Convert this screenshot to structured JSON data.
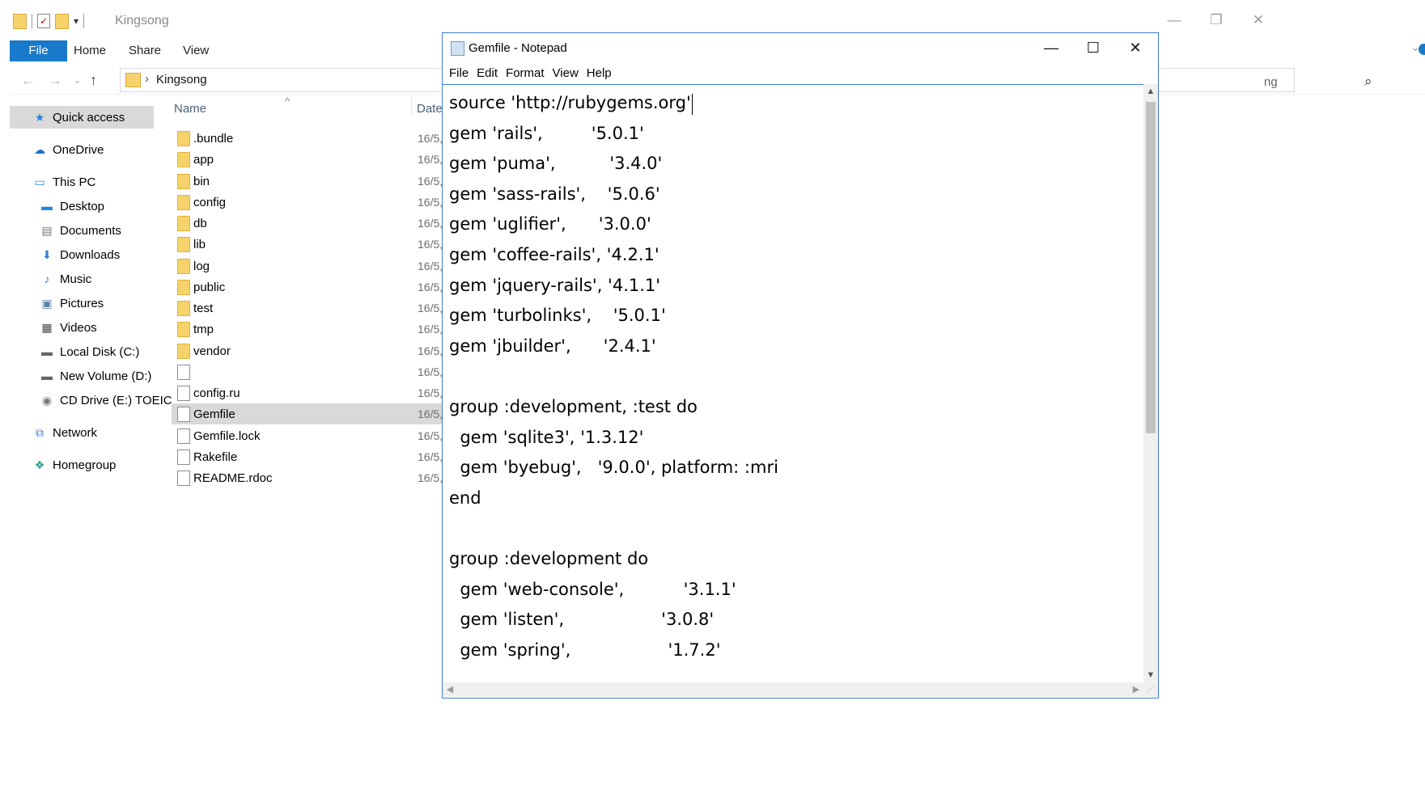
{
  "explorer": {
    "title": "Kingsong",
    "window_controls": {
      "minimize": "—",
      "restore": "❐",
      "close": "✕"
    },
    "ribbon": {
      "file": "File",
      "home": "Home",
      "share": "Share",
      "view": "View"
    },
    "nav_glyphs": {
      "back": "←",
      "forward": "→",
      "recent": "⌄",
      "up": "↑",
      "path_sep": "›",
      "chevron": "⌄",
      "search": "⌕"
    },
    "address": {
      "path": "Kingsong"
    },
    "search": {
      "partial_text": "ng"
    },
    "nav_pane": {
      "quick_access": "Quick access",
      "onedrive": "OneDrive",
      "this_pc": "This PC",
      "desktop": "Desktop",
      "documents": "Documents",
      "downloads": "Downloads",
      "music": "Music",
      "pictures": "Pictures",
      "videos": "Videos",
      "local_disk": "Local Disk (C:)",
      "new_volume": "New Volume (D:)",
      "cd_drive": "CD Drive (E:) TOEIC",
      "network": "Network",
      "homegroup": "Homegroup"
    },
    "columns": {
      "name": "Name",
      "date": "Date",
      "sort_glyph": "^"
    },
    "files": [
      {
        "name": ".bundle",
        "date": "16/5,",
        "kind": "folder"
      },
      {
        "name": "app",
        "date": "16/5,",
        "kind": "folder"
      },
      {
        "name": "bin",
        "date": "16/5,",
        "kind": "folder"
      },
      {
        "name": "config",
        "date": "16/5,",
        "kind": "folder"
      },
      {
        "name": "db",
        "date": "16/5,",
        "kind": "folder"
      },
      {
        "name": "lib",
        "date": "16/5,",
        "kind": "folder"
      },
      {
        "name": "log",
        "date": "16/5,",
        "kind": "folder"
      },
      {
        "name": "public",
        "date": "16/5,",
        "kind": "folder"
      },
      {
        "name": "test",
        "date": "16/5,",
        "kind": "folder"
      },
      {
        "name": "tmp",
        "date": "16/5,",
        "kind": "folder"
      },
      {
        "name": "vendor",
        "date": "16/5,",
        "kind": "folder"
      },
      {
        "name": "",
        "date": "16/5,",
        "kind": "file"
      },
      {
        "name": "config.ru",
        "date": "16/5,",
        "kind": "file"
      },
      {
        "name": "Gemfile",
        "date": "16/5,",
        "kind": "file",
        "selected": true
      },
      {
        "name": "Gemfile.lock",
        "date": "16/5,",
        "kind": "file"
      },
      {
        "name": "Rakefile",
        "date": "16/5,",
        "kind": "file"
      },
      {
        "name": "README.rdoc",
        "date": "16/5,",
        "kind": "file"
      }
    ]
  },
  "notepad": {
    "title": "Gemfile - Notepad",
    "controls": {
      "minimize": "—",
      "maximize": "☐",
      "close": "✕"
    },
    "menu": {
      "file": "File",
      "edit": "Edit",
      "format": "Format",
      "view": "View",
      "help": "Help"
    },
    "scroll_glyphs": {
      "up": "▲",
      "down": "▼",
      "left": "◀",
      "right": "▶",
      "grip": "⋰"
    },
    "lines": [
      "source 'http://rubygems.org'",
      "gem 'rails',         '5.0.1'",
      "gem 'puma',          '3.4.0'",
      "gem 'sass-rails',    '5.0.6'",
      "gem 'uglifier',      '3.0.0'",
      "gem 'coffee-rails', '4.2.1'",
      "gem 'jquery-rails', '4.1.1'",
      "gem 'turbolinks',    '5.0.1'",
      "gem 'jbuilder',      '2.4.1'",
      "",
      "group :development, :test do",
      "  gem 'sqlite3', '1.3.12'",
      "  gem 'byebug',   '9.0.0', platform: :mri",
      "end",
      "",
      "group :development do",
      "  gem 'web-console',           '3.1.1'",
      "  gem 'listen',                  '3.0.8'",
      "  gem 'spring',                  '1.7.2'"
    ]
  }
}
